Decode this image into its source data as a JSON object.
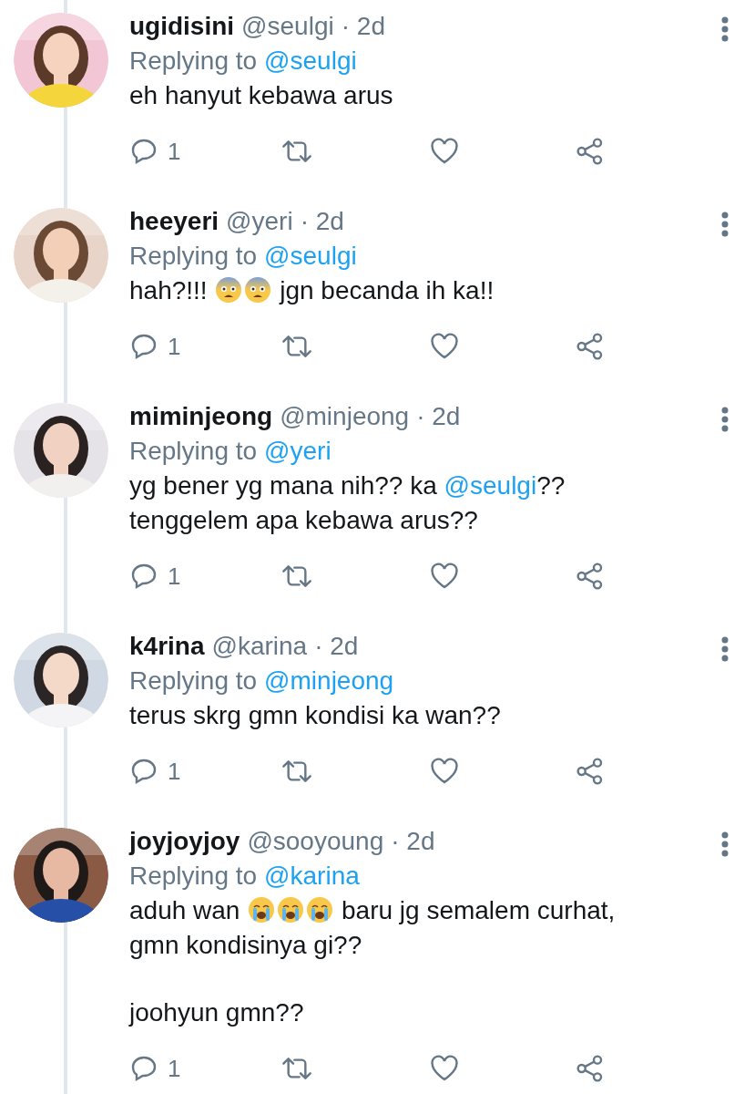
{
  "tweets": [
    {
      "name": "ugidisini",
      "handle": "@seulgi",
      "time": "· 2d",
      "replying_label": "Replying to",
      "replying_to": "@seulgi",
      "replies": "1",
      "body": [
        [
          {
            "kind": "text",
            "text": "eh hanyut kebawa arus"
          }
        ]
      ]
    },
    {
      "name": "heeyeri",
      "handle": "@yeri",
      "time": "· 2d",
      "replying_label": "Replying to",
      "replying_to": "@seulgi",
      "replies": "1",
      "body": [
        [
          {
            "kind": "text",
            "text": "hah?!!! "
          },
          {
            "kind": "fearful"
          },
          {
            "kind": "fearful"
          },
          {
            "kind": "text",
            "text": " jgn becanda ih ka!!"
          }
        ]
      ]
    },
    {
      "name": "miminjeong",
      "handle": "@minjeong",
      "time": "· 2d",
      "replying_label": "Replying to",
      "replying_to": "@yeri",
      "replies": "1",
      "body": [
        [
          {
            "kind": "text",
            "text": "yg bener yg mana nih?? ka "
          },
          {
            "kind": "mention",
            "text": "@seulgi"
          },
          {
            "kind": "text",
            "text": "?? tenggelem apa kebawa arus??"
          }
        ]
      ]
    },
    {
      "name": "k4rina",
      "handle": "@karina",
      "time": "· 2d",
      "replying_label": "Replying to",
      "replying_to": "@minjeong",
      "replies": "1",
      "body": [
        [
          {
            "kind": "text",
            "text": "terus skrg gmn kondisi ka wan??"
          }
        ]
      ]
    },
    {
      "name": "joyjoyjoy",
      "handle": "@sooyoung",
      "time": "· 2d",
      "replying_label": "Replying to",
      "replying_to": "@karina",
      "replies": "1",
      "body": [
        [
          {
            "kind": "text",
            "text": "aduh wan "
          },
          {
            "kind": "crying"
          },
          {
            "kind": "crying"
          },
          {
            "kind": "crying"
          },
          {
            "kind": "text",
            "text": " baru jg semalem curhat, gmn kondisinya gi??"
          }
        ],
        [
          {
            "kind": "text",
            "text": "joohyun gmn??"
          }
        ]
      ]
    }
  ]
}
